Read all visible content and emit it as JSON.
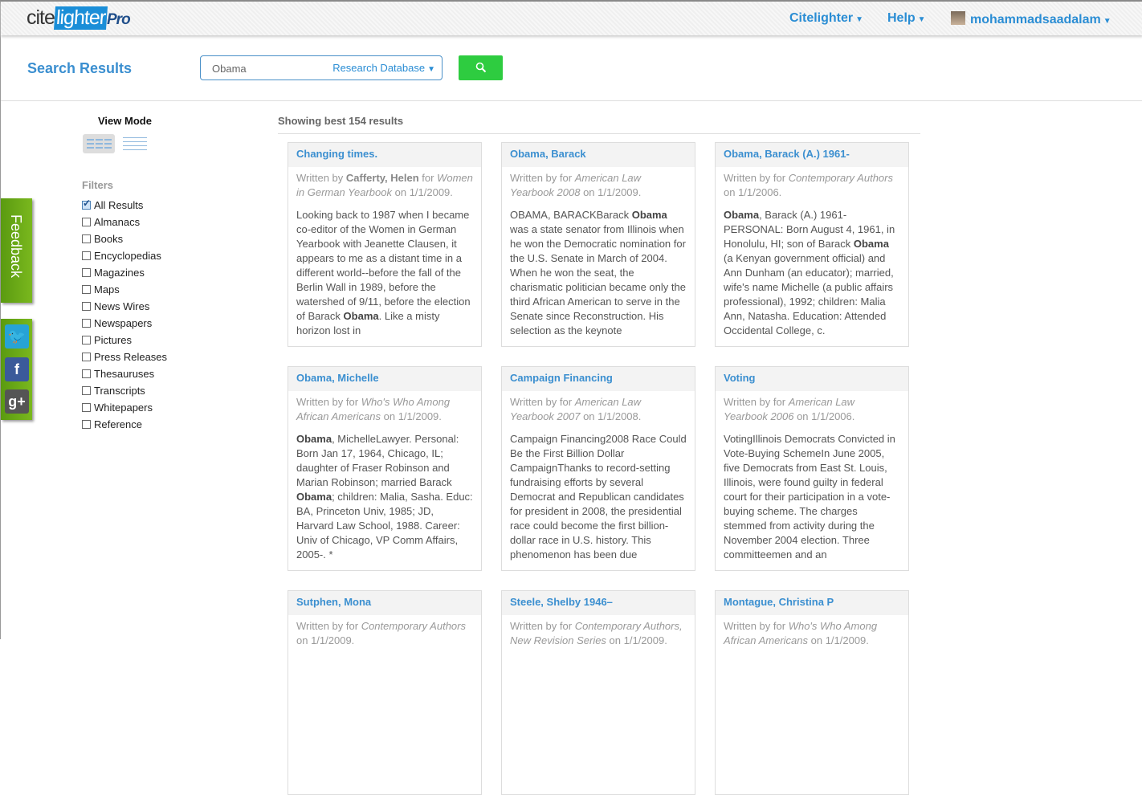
{
  "header": {
    "logo": {
      "a": "cite",
      "b": "lighter",
      "c": "Pro"
    },
    "nav": [
      "Citelighter",
      "Help"
    ],
    "user": "mohammadsaadalam"
  },
  "search": {
    "title": "Search Results",
    "query": "Obama",
    "database": "Research Database"
  },
  "sidebar": {
    "view_mode": "View Mode",
    "filters_label": "Filters",
    "filters": [
      {
        "label": "All Results",
        "checked": true
      },
      {
        "label": "Almanacs"
      },
      {
        "label": "Books"
      },
      {
        "label": "Encyclopedias"
      },
      {
        "label": "Magazines"
      },
      {
        "label": "Maps"
      },
      {
        "label": "News Wires"
      },
      {
        "label": "Newspapers"
      },
      {
        "label": "Pictures"
      },
      {
        "label": "Press Releases"
      },
      {
        "label": "Thesauruses"
      },
      {
        "label": "Transcripts"
      },
      {
        "label": "Whitepapers"
      },
      {
        "label": "Reference"
      }
    ],
    "feedback": "Feedback"
  },
  "results": {
    "summary": "Showing best 154 results",
    "cards": [
      {
        "title": "Changing times.",
        "author": "Cafferty, Helen",
        "source": "Women in German Yearbook",
        "date": "1/1/2009.",
        "body": [
          [
            "Looking back to 1987 when I became co-editor of the Women in German Yearbook with Jeanette Clausen, it appears to me as a distant time in a different world--before the fall of the Berlin Wall in 1989, before the watershed of 9/11, before the election of Barack ",
            0
          ],
          [
            "Obama",
            1
          ],
          [
            ". Like a misty horizon lost in",
            0
          ]
        ]
      },
      {
        "title": "Obama, Barack",
        "author": "",
        "source": "American Law Yearbook 2008",
        "date": "1/1/2009.",
        "body": [
          [
            "OBAMA, BARACKBarack ",
            0
          ],
          [
            "Obama",
            1
          ],
          [
            " was a state senator from Illinois when he won the Democratic nomination for the U.S. Senate in March of 2004. When he won the seat, the charismatic politician became only the third African American to serve in the Senate since Reconstruction. His selection as the keynote",
            0
          ]
        ]
      },
      {
        "title": "Obama, Barack (A.) 1961-",
        "author": "",
        "source": "Contemporary Authors",
        "date": "1/1/2006.",
        "body": [
          [
            "Obama",
            1
          ],
          [
            ", Barack (A.) 1961- PERSONAL: Born August 4, 1961, in Honolulu, HI; son of Barack ",
            0
          ],
          [
            "Obama",
            1
          ],
          [
            " (a Kenyan government official) and Ann Dunham (an educator); married, wife's name Michelle (a public affairs professional), 1992; children: Malia Ann, Natasha. Education: Attended Occidental College, c.",
            0
          ]
        ]
      },
      {
        "title": "Obama, Michelle",
        "author": "",
        "source": "Who's Who Among African Americans",
        "date": "1/1/2009.",
        "body": [
          [
            "Obama",
            1
          ],
          [
            ", MichelleLawyer. Personal: Born Jan 17, 1964, Chicago, IL; daughter of Fraser Robinson and Marian Robinson; married Barack ",
            0
          ],
          [
            "Obama",
            1
          ],
          [
            "; children: Malia, Sasha. Educ: BA, Princeton Univ, 1985; JD, Harvard Law School, 1988. Career: Univ of Chicago, VP Comm Affairs, 2005-. *",
            0
          ]
        ]
      },
      {
        "title": "Campaign Financing",
        "author": "",
        "source": "American Law Yearbook 2007",
        "date": "1/1/2008.",
        "body": [
          [
            "Campaign Financing2008 Race Could Be the First Billion Dollar CampaignThanks to record-setting fundraising efforts by several Democrat and Republican candidates for president in 2008, the presidential race could become the first billion-dollar race in U.S. history. This phenomenon has been due",
            0
          ]
        ]
      },
      {
        "title": "Voting",
        "author": "",
        "source": "American Law Yearbook 2006",
        "date": "1/1/2006.",
        "body": [
          [
            "VotingIllinois Democrats Convicted in Vote-Buying SchemeIn June 2005, five Democrats from East St. Louis, Illinois, were found guilty in federal court for their participation in a vote-buying scheme. The charges stemmed from activity during the November 2004 election. Three committeemen and an",
            0
          ]
        ]
      },
      {
        "title": "Sutphen, Mona",
        "author": "",
        "source": "Contemporary Authors",
        "date": "1/1/2009.",
        "body": []
      },
      {
        "title": "Steele, Shelby 1946–",
        "author": "",
        "source": "Contemporary Authors, New Revision Series",
        "date": "1/1/2009.",
        "body": []
      },
      {
        "title": "Montague, Christina P",
        "author": "",
        "source": "Who's Who Among African Americans",
        "date": "1/1/2009.",
        "body": []
      }
    ],
    "labels": {
      "written_by": "Written by ",
      "for": " for ",
      "on": " on "
    }
  }
}
